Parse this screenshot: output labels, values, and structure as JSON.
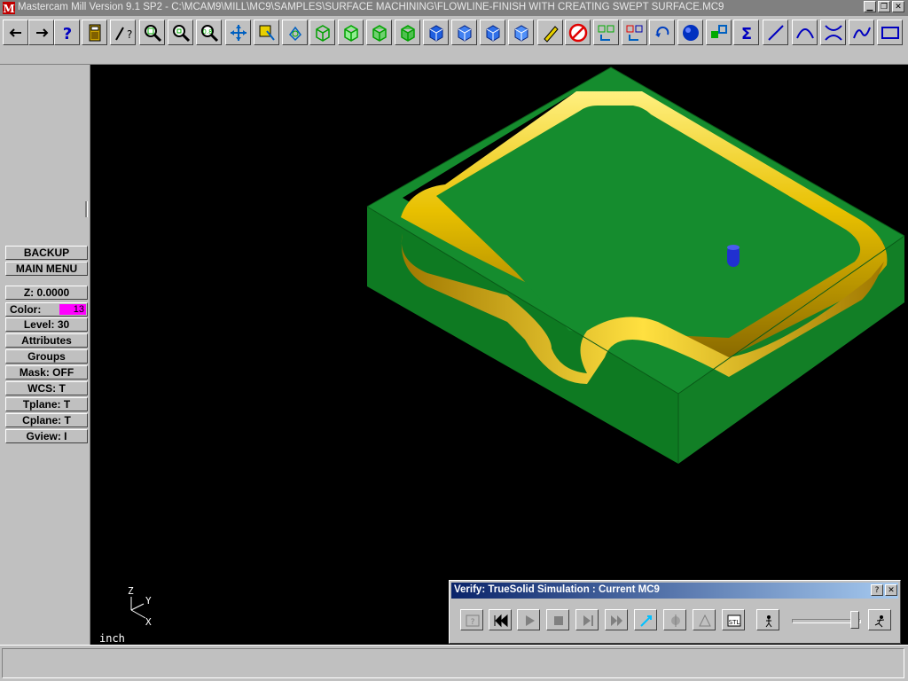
{
  "window": {
    "title": "Mastercam Mill Version 9.1 SP2 - C:\\MCAM9\\MILL\\MC9\\SAMPLES\\SURFACE MACHINING\\FLOWLINE-FINISH WITH CREATING SWEPT SURFACE.MC9",
    "controls": [
      "minimize-icon",
      "restore-icon",
      "close-icon"
    ]
  },
  "toolbar": {
    "icons": [
      "arrow-left-icon",
      "arrow-right-icon",
      "help-icon",
      "calculator-icon",
      "analyze-icon",
      "zoom-window-icon",
      "unzoom-icon",
      "zoom-fit-icon",
      "pan-icon",
      "select-icon",
      "rotate-view-icon",
      "iso-view-icon",
      "top-view-icon",
      "front-view-icon",
      "side-view-icon",
      "blue-cube-1-icon",
      "blue-cube-2-icon",
      "blue-cube-3-icon",
      "blue-cube-4-icon",
      "pencil-icon",
      "no-delete-icon",
      "transform-icon",
      "transform-color-icon",
      "undo-icon",
      "sphere-icon",
      "xform-icon",
      "sigma-icon",
      "line-icon",
      "arc-icon",
      "fillet-icon",
      "spline-icon",
      "rectangle-icon"
    ]
  },
  "menu": {
    "backup": "BACKUP",
    "main": "MAIN MENU",
    "z": "Z:  0.0000",
    "color_label": "Color:",
    "color_value": "13",
    "level": "Level: 30",
    "attributes": "Attributes",
    "groups": "Groups",
    "mask": "Mask:  OFF",
    "wcs": "WCS:   T",
    "tplane": "Tplane:   T",
    "cplane": "Cplane:   T",
    "gview": "Gview:   I"
  },
  "viewport": {
    "units": "inch",
    "axis_z": "Z",
    "axis_y": "Y",
    "axis_x": "X"
  },
  "verify": {
    "title": "Verify: TrueSolid Simulation : Current MC9",
    "help": "?",
    "close": "✕"
  },
  "colors": {
    "part_green": "#158c2e",
    "fillet_yellow": "#e8c000",
    "tool_blue": "#2030d0",
    "background": "#000000"
  }
}
